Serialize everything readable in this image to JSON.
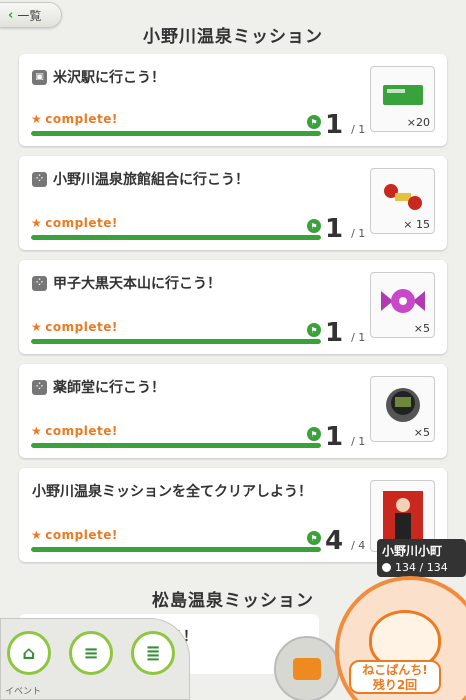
{
  "nav": {
    "back_label": "一覧"
  },
  "sections": [
    {
      "title": "小野川温泉ミッション"
    },
    {
      "title": "松島温泉ミッション"
    }
  ],
  "missions": [
    {
      "title": "米沢駅に行こう！",
      "icon": "train-icon",
      "status": "complete!",
      "progress": 1,
      "total": 1,
      "total_label": "/ 1",
      "reward_qty": "×20",
      "reward_icon": "ticket-icon"
    },
    {
      "title": "小野川温泉旅館組合に行こう！",
      "icon": "footprint-icon",
      "status": "complete!",
      "progress": 1,
      "total": 1,
      "total_label": "/ 1",
      "reward_qty": "× 15",
      "reward_icon": "ribbon-icon"
    },
    {
      "title": "甲子大黒天本山に行こう！",
      "icon": "footprint-icon",
      "status": "complete!",
      "progress": 1,
      "total": 1,
      "total_label": "/ 1",
      "reward_qty": "×5",
      "reward_icon": "candy-icon"
    },
    {
      "title": "薬師堂に行こう！",
      "icon": "footprint-icon",
      "status": "complete!",
      "progress": 1,
      "total": 1,
      "total_label": "/ 1",
      "reward_qty": "×5",
      "reward_icon": "grill-icon"
    },
    {
      "title": "小野川温泉ミッションを全てクリアしよう！",
      "icon": "",
      "status": "complete!",
      "progress": 4,
      "total": 4,
      "total_label": "/ 4",
      "reward_qty": "",
      "reward_icon": "character-card-icon"
    }
  ],
  "character": {
    "name": "小野川小町",
    "stat": "134 / 134"
  },
  "partial_mission_title": "う！",
  "bottom_nav": {
    "event_label": "イベント"
  },
  "neko_button": {
    "line1": "ねこぱんち!",
    "line2": "残り2回"
  },
  "colors": {
    "accent_green": "#3aa23a",
    "accent_orange": "#ee7a1f",
    "background": "#efefec"
  }
}
